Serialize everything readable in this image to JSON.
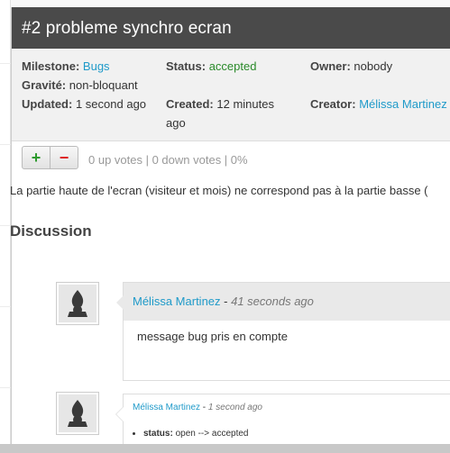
{
  "header": {
    "title": "#2 probleme synchro ecran"
  },
  "meta": {
    "milestone_label": "Milestone:",
    "milestone_value": "Bugs",
    "status_label": "Status:",
    "status_value": "accepted",
    "owner_label": "Owner:",
    "owner_value": "nobody",
    "gravite_label": "Gravité:",
    "gravite_value": "non-bloquant",
    "updated_label": "Updated:",
    "updated_value": "1 second ago",
    "created_label": "Created:",
    "created_value_1": "12 minutes",
    "created_value_2": "ago",
    "creator_label": "Creator:",
    "creator_value": "Mélissa Martinez"
  },
  "votes": {
    "up_label": "+",
    "down_label": "−",
    "summary": "0 up votes | 0 down votes | 0%"
  },
  "description": "La partie haute de l'ecran (visiteur et mois) ne correspond pas à la partie basse (",
  "discussion": {
    "title": "Discussion",
    "comments": [
      {
        "author": "Mélissa Martinez",
        "separator": " - ",
        "time": "41 seconds ago",
        "body": "message bug pris en compte"
      },
      {
        "author": "Mélissa Martinez",
        "separator": " - ",
        "time": "1 second ago",
        "change_label": "status:",
        "change_value": "open --> accepted"
      }
    ]
  },
  "colors": {
    "header_bg": "#4a4a4a",
    "link": "#1f9ac9",
    "status_accepted": "#2a8a2a"
  }
}
